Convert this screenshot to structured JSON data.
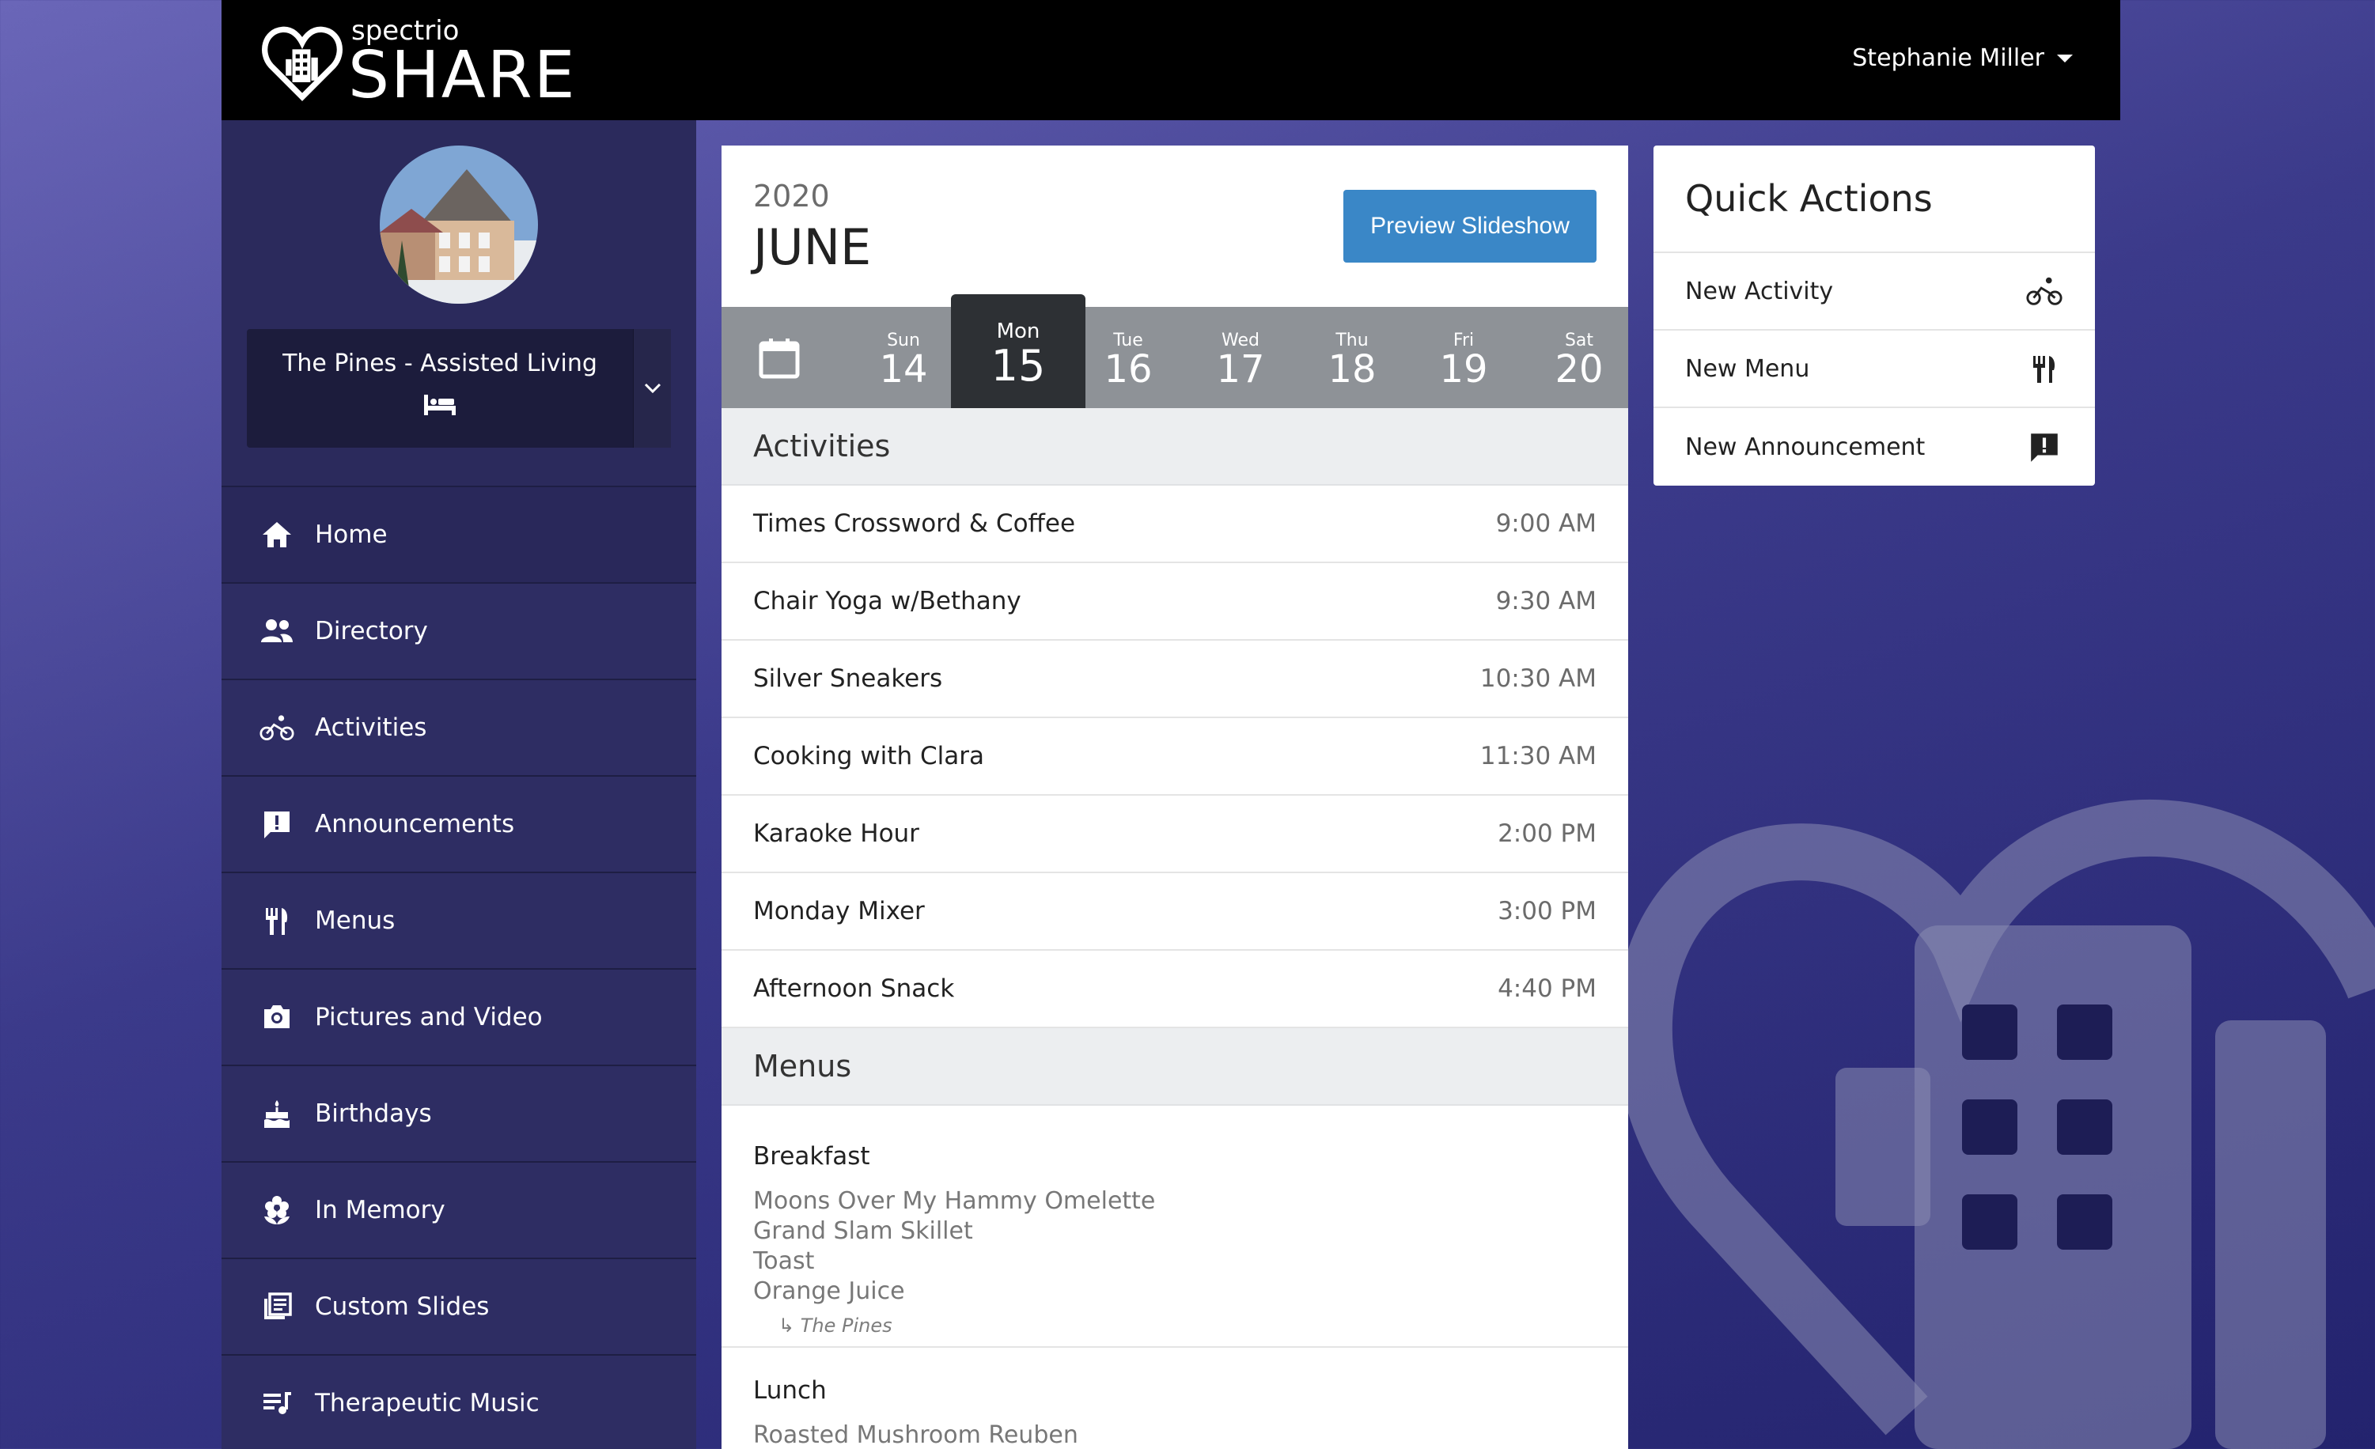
{
  "brand": {
    "small": "spectrio",
    "big": "SHARE"
  },
  "user": {
    "name": "Stephanie Miller"
  },
  "community": {
    "name": "The Pines - Assisted Living"
  },
  "nav": [
    {
      "label": "Home",
      "icon": "home-icon"
    },
    {
      "label": "Directory",
      "icon": "people-icon"
    },
    {
      "label": "Activities",
      "icon": "bike-icon"
    },
    {
      "label": "Announcements",
      "icon": "announcement-icon"
    },
    {
      "label": "Menus",
      "icon": "utensils-icon"
    },
    {
      "label": "Pictures and Video",
      "icon": "camera-icon"
    },
    {
      "label": "Birthdays",
      "icon": "cake-icon"
    },
    {
      "label": "In Memory",
      "icon": "flower-icon"
    },
    {
      "label": "Custom Slides",
      "icon": "slides-icon"
    },
    {
      "label": "Therapeutic Music",
      "icon": "music-icon"
    }
  ],
  "calendar": {
    "year": "2020",
    "month": "JUNE",
    "preview_label": "Preview Slideshow",
    "days": [
      {
        "name": "Sun",
        "num": "14"
      },
      {
        "name": "Mon",
        "num": "15"
      },
      {
        "name": "Tue",
        "num": "16"
      },
      {
        "name": "Wed",
        "num": "17"
      },
      {
        "name": "Thu",
        "num": "18"
      },
      {
        "name": "Fri",
        "num": "19"
      },
      {
        "name": "Sat",
        "num": "20"
      }
    ],
    "selected_day": "Mon"
  },
  "activities": {
    "heading": "Activities",
    "items": [
      {
        "name": "Times Crossword & Coffee",
        "time": "9:00 AM"
      },
      {
        "name": "Chair Yoga w/Bethany",
        "time": "9:30 AM"
      },
      {
        "name": "Silver Sneakers",
        "time": "10:30 AM"
      },
      {
        "name": "Cooking with Clara",
        "time": "11:30 AM"
      },
      {
        "name": "Karaoke Hour",
        "time": "2:00 PM"
      },
      {
        "name": "Monday Mixer",
        "time": "3:00 PM"
      },
      {
        "name": "Afternoon Snack",
        "time": "4:40 PM"
      }
    ]
  },
  "menus": {
    "heading": "Menus",
    "breakfast": {
      "meal": "Breakfast",
      "dishes": [
        "Moons Over My Hammy Omelette",
        "Grand Slam Skillet",
        "Toast",
        "Orange Juice"
      ],
      "source": "↳ The Pines"
    },
    "lunch": {
      "meal": "Lunch",
      "dishes": [
        "Roasted Mushroom Reuben"
      ]
    }
  },
  "quick_actions": {
    "title": "Quick Actions",
    "items": [
      {
        "label": "New Activity",
        "icon": "bike-icon"
      },
      {
        "label": "New Menu",
        "icon": "utensils-icon"
      },
      {
        "label": "New Announcement",
        "icon": "announcement-icon"
      }
    ]
  },
  "colors": {
    "topbar": "#000000",
    "sidebar": "#2e2d63",
    "accent_button": "#3a87c7",
    "week_strip": "#8e9297",
    "selected_day": "#2d3034"
  }
}
